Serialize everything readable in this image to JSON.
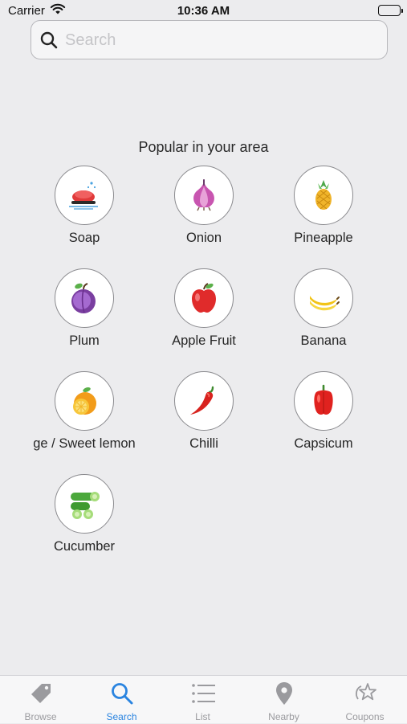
{
  "status_bar": {
    "carrier": "Carrier",
    "time": "10:36 AM"
  },
  "search": {
    "placeholder": "Search",
    "value": ""
  },
  "section_title": "Popular in your area",
  "items": [
    {
      "label": "Soap",
      "icon": "soap-icon"
    },
    {
      "label": "Onion",
      "icon": "onion-icon"
    },
    {
      "label": "Pineapple",
      "icon": "pineapple-icon"
    },
    {
      "label": "Plum",
      "icon": "plum-icon"
    },
    {
      "label": "Apple Fruit",
      "icon": "apple-icon"
    },
    {
      "label": "Banana",
      "icon": "banana-icon"
    },
    {
      "label": "ge / Sweet lemon",
      "icon": "orange-icon"
    },
    {
      "label": "Chilli",
      "icon": "chilli-icon"
    },
    {
      "label": "Capsicum",
      "icon": "capsicum-icon"
    },
    {
      "label": "Cucumber",
      "icon": "cucumber-icon"
    }
  ],
  "tabs": [
    {
      "label": "Browse",
      "icon": "tag-icon",
      "active": false
    },
    {
      "label": "Search",
      "icon": "search-icon",
      "active": true
    },
    {
      "label": "List",
      "icon": "list-icon",
      "active": false
    },
    {
      "label": "Nearby",
      "icon": "location-pin-icon",
      "active": false
    },
    {
      "label": "Coupons",
      "icon": "star-coupon-icon",
      "active": false
    }
  ],
  "colors": {
    "accent": "#2a84e0",
    "inactive_tab": "#9a9a9e",
    "background": "#ececee"
  }
}
